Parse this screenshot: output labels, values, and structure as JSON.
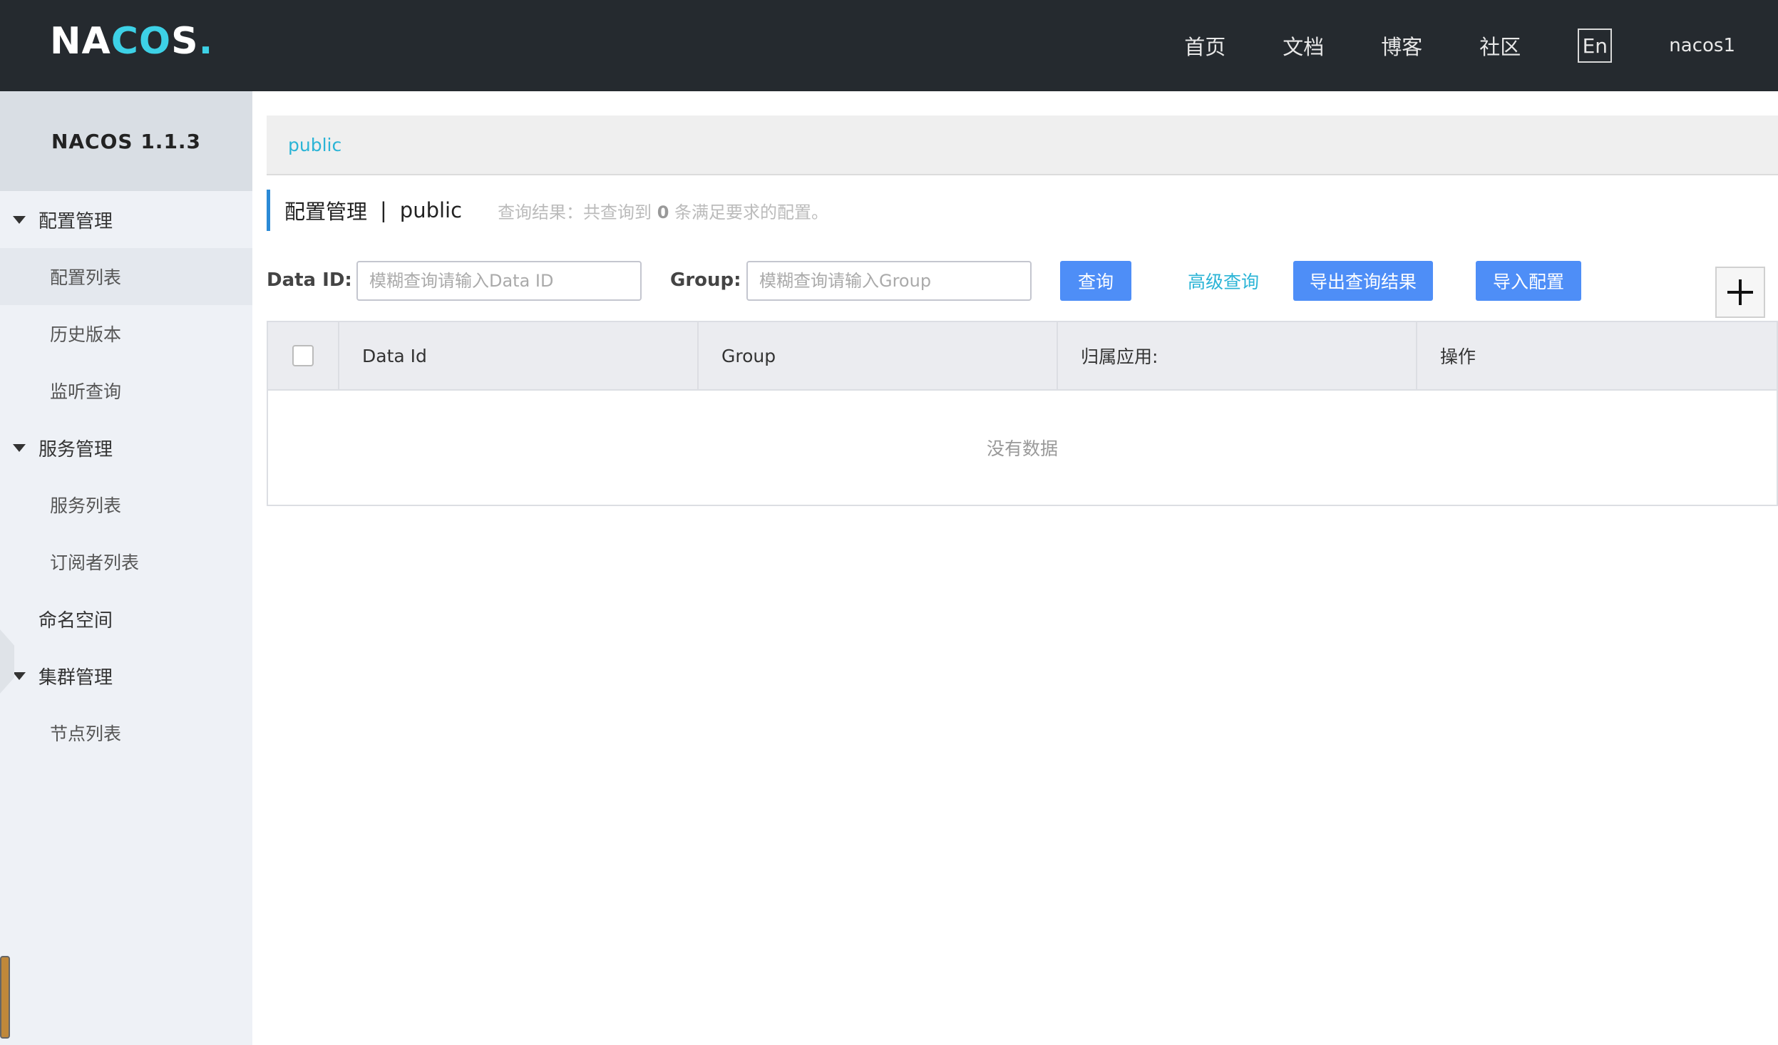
{
  "header": {
    "logo_text": "NACOS",
    "nav": [
      "首页",
      "文档",
      "博客",
      "社区"
    ],
    "lang_label": "En",
    "username": "nacos1"
  },
  "sidebar": {
    "title": "NACOS 1.1.3",
    "groups": [
      {
        "label": "配置管理",
        "items": [
          "配置列表",
          "历史版本",
          "监听查询"
        ]
      },
      {
        "label": "服务管理",
        "items": [
          "服务列表",
          "订阅者列表"
        ]
      }
    ],
    "single": "命名空间",
    "groups2": [
      {
        "label": "集群管理",
        "items": [
          "节点列表"
        ]
      }
    ]
  },
  "breadcrumb": {
    "namespace": "public"
  },
  "page": {
    "title": "配置管理",
    "separator": "|",
    "namespace": "public",
    "result_prefix": "查询结果：共查询到",
    "result_count": "0",
    "result_suffix": "条满足要求的配置。"
  },
  "filters": {
    "data_id_label": "Data ID:",
    "data_id_placeholder": "模糊查询请输入Data ID",
    "group_label": "Group:",
    "group_placeholder": "模糊查询请输入Group",
    "query_button": "查询",
    "advanced_query": "高级查询",
    "export_button": "导出查询结果",
    "import_button": "导入配置"
  },
  "table": {
    "columns": [
      "Data Id",
      "Group",
      "归属应用:",
      "操作"
    ],
    "empty_text": "没有数据"
  },
  "colors": {
    "header_bg": "#252a2f",
    "accent_blue": "#4e8ef7",
    "link_cyan": "#2bb4d6",
    "sidebar_bg": "#eef1f6"
  }
}
